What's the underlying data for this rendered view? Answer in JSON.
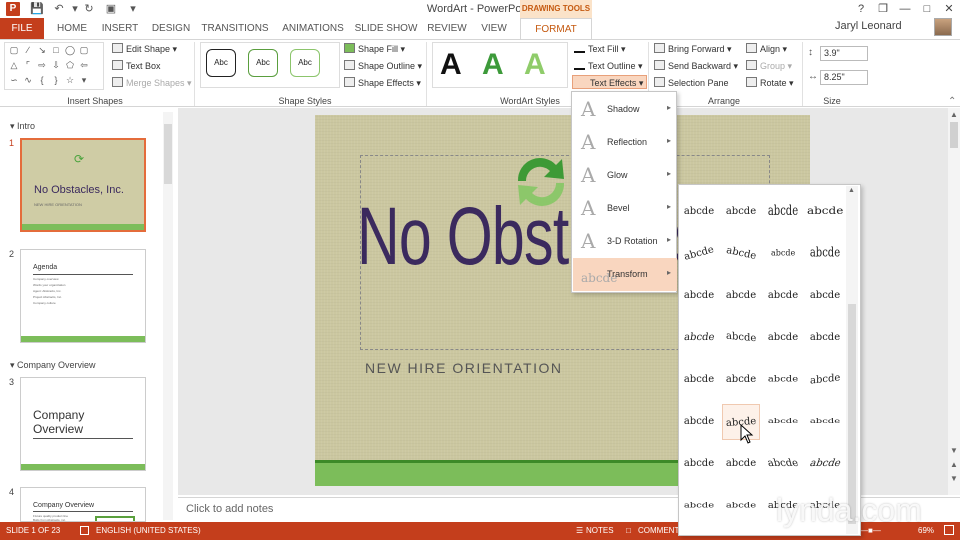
{
  "window": {
    "title": "WordArt - PowerPoint",
    "context_group": "DRAWING TOOLS",
    "user": "Jaryl Leonard",
    "qat": [
      "save-icon",
      "undo-icon",
      "redo-icon",
      "start-from-beginning-icon",
      "customize-icon"
    ],
    "controls": [
      "?",
      "❐",
      "—",
      "□",
      "✕"
    ]
  },
  "tabs": [
    "FILE",
    "HOME",
    "INSERT",
    "DESIGN",
    "TRANSITIONS",
    "ANIMATIONS",
    "SLIDE SHOW",
    "REVIEW",
    "VIEW",
    "FORMAT"
  ],
  "ribbon": {
    "insert_shapes": {
      "label": "Insert Shapes",
      "edit_shape": "Edit Shape",
      "text_box": "Text Box",
      "merge_shapes": "Merge Shapes"
    },
    "shape_styles": {
      "label": "Shape Styles",
      "swatch": "Abc",
      "fill": "Shape Fill",
      "outline": "Shape Outline",
      "effects": "Shape Effects"
    },
    "wordart_styles": {
      "label": "WordArt Styles",
      "letter": "A",
      "text_fill": "Text Fill",
      "text_outline": "Text Outline",
      "text_effects": "Text Effects"
    },
    "arrange": {
      "label": "Arrange",
      "bring_forward": "Bring Forward",
      "send_backward": "Send Backward",
      "selection_pane": "Selection Pane",
      "align": "Align",
      "group": "Group",
      "rotate": "Rotate"
    },
    "size": {
      "label": "Size",
      "height": "3.9\"",
      "width": "8.25\""
    }
  },
  "slides": {
    "section_intro": "Intro",
    "section_company": "Company Overview",
    "s1": {
      "num": "1",
      "title": "No Obstacles, Inc.",
      "sub": "NEW HIRE ORIENTATION"
    },
    "s2": {
      "num": "2",
      "title": "Agenda",
      "lines": [
        "Company overview",
        "Words your organization",
        "Agent: Abstracts, Inc.",
        "Project Abstracts, Inc.",
        "Company culture"
      ]
    },
    "s3": {
      "num": "3",
      "title": "Company Overview"
    },
    "s4": {
      "num": "4",
      "title": "Company Overview",
      "lines": [
        "Fixture quality product line",
        "Bolts from Abstracts, inc."
      ]
    }
  },
  "slide": {
    "title": "No Obstacles, Inc.",
    "subtitle": "NEW HIRE ORIENTATION"
  },
  "notes_placeholder": "Click to add notes",
  "effects_menu": [
    {
      "label": "Shadow"
    },
    {
      "label": "Reflection"
    },
    {
      "label": "Glow"
    },
    {
      "label": "Bevel"
    },
    {
      "label": "3-D Rotation"
    },
    {
      "label": "Transform",
      "selected": true
    }
  ],
  "transform_gallery": {
    "sample": "abcde",
    "rows": 8,
    "cols": 4,
    "highlighted": [
      5,
      1
    ]
  },
  "status": {
    "slide": "SLIDE 1 OF 23",
    "language": "ENGLISH (UNITED STATES)",
    "notes": "NOTES",
    "comments": "COMMENTS",
    "zoom": "69%"
  },
  "watermark": "lynda.com",
  "colors": {
    "accent": "#c43e1c",
    "format_tab": "#c55a11",
    "slide_bg": "#cbc7a0",
    "title": "#3b2a5e",
    "strip": "#7cbd5a",
    "selected_menu": "#f9d6bf"
  }
}
